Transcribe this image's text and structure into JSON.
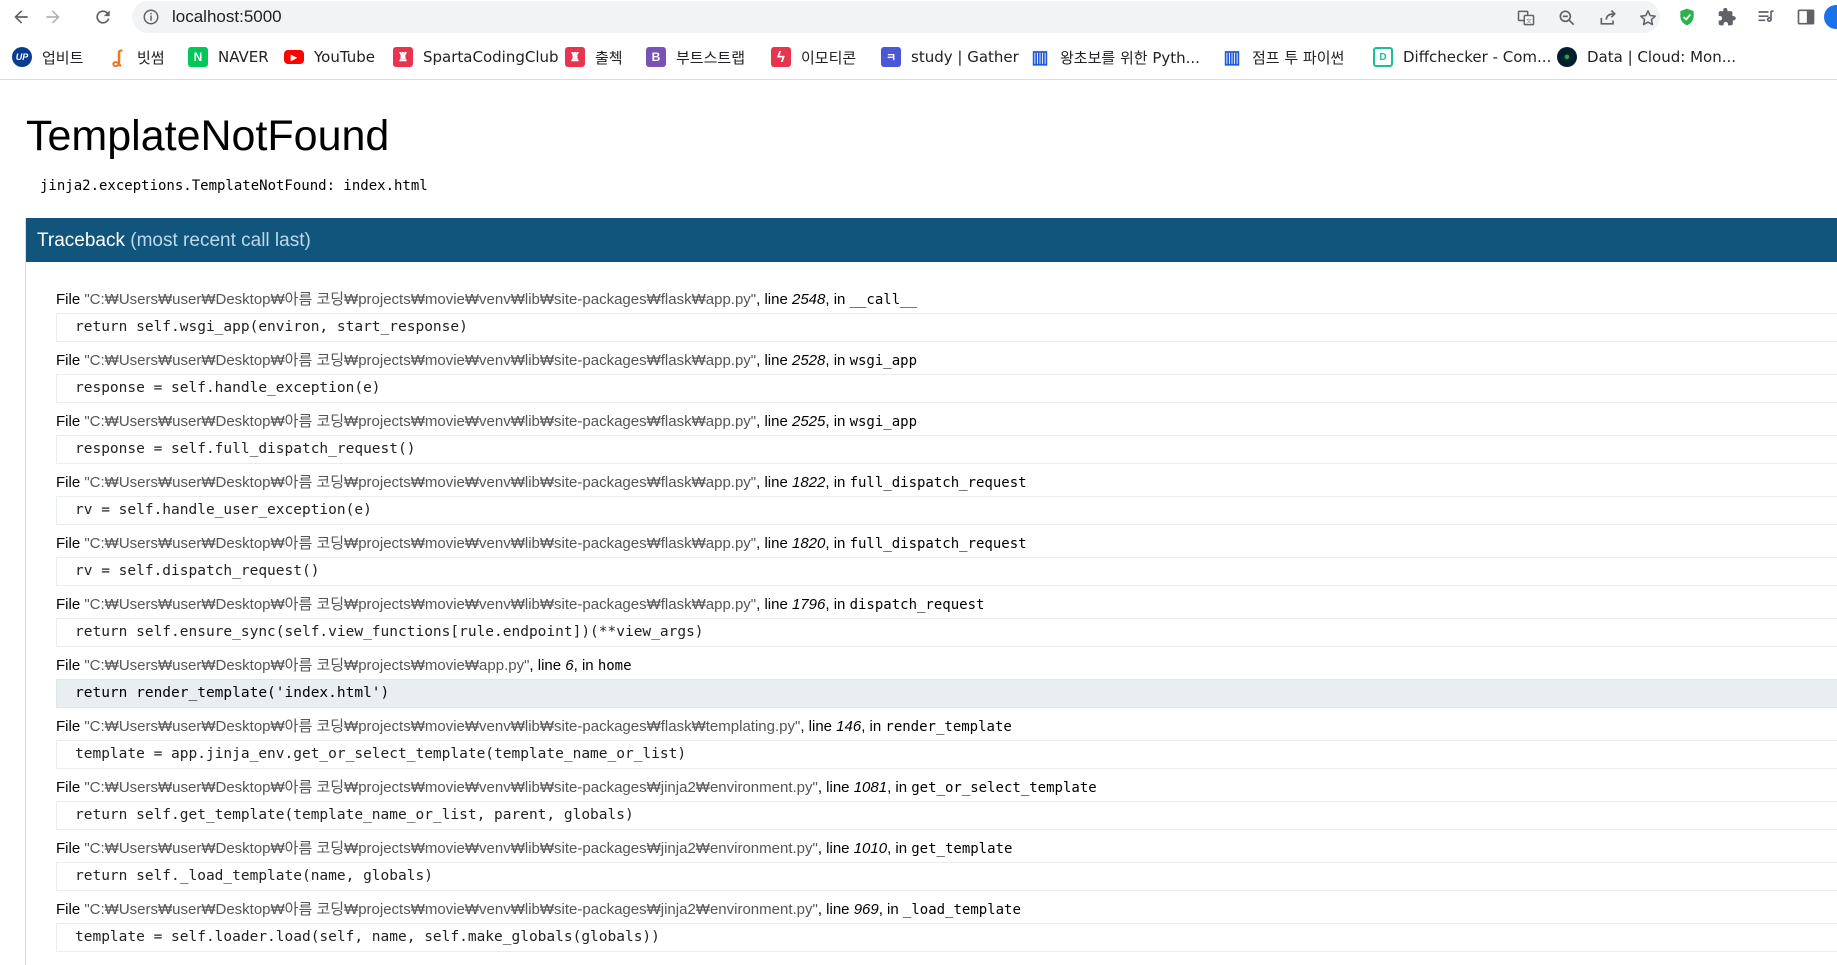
{
  "browser": {
    "url": "localhost:5000",
    "bookmarks": [
      {
        "label": "업비트",
        "icon": "upbit-icon",
        "color": "#0a3d91",
        "glyph": "UP"
      },
      {
        "label": "빗썸",
        "icon": "bithumb-icon",
        "color": "#f37321",
        "glyph": "ʆ"
      },
      {
        "label": "NAVER",
        "icon": "naver-icon",
        "color": "#03c75a",
        "glyph": "N"
      },
      {
        "label": "YouTube",
        "icon": "youtube-icon",
        "color": "#ff0000",
        "glyph": "▶"
      },
      {
        "label": "SpartaCodingClub",
        "icon": "sparta-icon",
        "color": "#e8344e",
        "glyph": "♜"
      },
      {
        "label": "출첵",
        "icon": "sparta-icon",
        "color": "#e8344e",
        "glyph": "♜"
      },
      {
        "label": "부트스트랩",
        "icon": "bootstrap-icon",
        "color": "#7952b3",
        "glyph": "B"
      },
      {
        "label": "이모티콘",
        "icon": "emoticon-icon",
        "color": "#e8344e",
        "glyph": "ϟ"
      },
      {
        "label": "study | Gather",
        "icon": "gather-icon",
        "color": "#4a57d6",
        "glyph": "ㅋ"
      },
      {
        "label": "왕초보를 위한 Pyth...",
        "icon": "book-icon",
        "color": "#1f5bd8",
        "glyph": "▥"
      },
      {
        "label": "점프 투 파이썬",
        "icon": "book-icon",
        "color": "#1f5bd8",
        "glyph": "▥"
      },
      {
        "label": "Diffchecker - Com...",
        "icon": "diffchecker-icon",
        "color": "#1bbd9b",
        "glyph": "D"
      },
      {
        "label": "Data | Cloud: Mon...",
        "icon": "mongodb-icon",
        "color": "#13aa52",
        "glyph": "●"
      }
    ]
  },
  "page": {
    "title": "TemplateNotFound",
    "message": "jinja2.exceptions.TemplateNotFound: index.html",
    "traceback_label": "Traceback",
    "traceback_sub": "(most recent call last)",
    "frames": [
      {
        "file": "\"C:₩Users₩user₩Desktop₩아름 코딩₩projects₩movie₩venv₩lib₩site-packages₩flask₩app.py\"",
        "line": "2548",
        "func": "__call__",
        "code": "return self.wsgi_app(environ, start_response)",
        "current": false
      },
      {
        "file": "\"C:₩Users₩user₩Desktop₩아름 코딩₩projects₩movie₩venv₩lib₩site-packages₩flask₩app.py\"",
        "line": "2528",
        "func": "wsgi_app",
        "code": "response = self.handle_exception(e)",
        "current": false
      },
      {
        "file": "\"C:₩Users₩user₩Desktop₩아름 코딩₩projects₩movie₩venv₩lib₩site-packages₩flask₩app.py\"",
        "line": "2525",
        "func": "wsgi_app",
        "code": "response = self.full_dispatch_request()",
        "current": false
      },
      {
        "file": "\"C:₩Users₩user₩Desktop₩아름 코딩₩projects₩movie₩venv₩lib₩site-packages₩flask₩app.py\"",
        "line": "1822",
        "func": "full_dispatch_request",
        "code": "rv = self.handle_user_exception(e)",
        "current": false
      },
      {
        "file": "\"C:₩Users₩user₩Desktop₩아름 코딩₩projects₩movie₩venv₩lib₩site-packages₩flask₩app.py\"",
        "line": "1820",
        "func": "full_dispatch_request",
        "code": "rv = self.dispatch_request()",
        "current": false
      },
      {
        "file": "\"C:₩Users₩user₩Desktop₩아름 코딩₩projects₩movie₩venv₩lib₩site-packages₩flask₩app.py\"",
        "line": "1796",
        "func": "dispatch_request",
        "code": "return self.ensure_sync(self.view_functions[rule.endpoint])(**view_args)",
        "current": false
      },
      {
        "file": "\"C:₩Users₩user₩Desktop₩아름 코딩₩projects₩movie₩app.py\"",
        "line": "6",
        "func": "home",
        "code": "return render_template('index.html')",
        "current": true
      },
      {
        "file": "\"C:₩Users₩user₩Desktop₩아름 코딩₩projects₩movie₩venv₩lib₩site-packages₩flask₩templating.py\"",
        "line": "146",
        "func": "render_template",
        "code": "template = app.jinja_env.get_or_select_template(template_name_or_list)",
        "current": false
      },
      {
        "file": "\"C:₩Users₩user₩Desktop₩아름 코딩₩projects₩movie₩venv₩lib₩site-packages₩jinja2₩environment.py\"",
        "line": "1081",
        "func": "get_or_select_template",
        "code": "return self.get_template(template_name_or_list, parent, globals)",
        "current": false
      },
      {
        "file": "\"C:₩Users₩user₩Desktop₩아름 코딩₩projects₩movie₩venv₩lib₩site-packages₩jinja2₩environment.py\"",
        "line": "1010",
        "func": "get_template",
        "code": "return self._load_template(name, globals)",
        "current": false
      },
      {
        "file": "\"C:₩Users₩user₩Desktop₩아름 코딩₩projects₩movie₩venv₩lib₩site-packages₩jinja2₩environment.py\"",
        "line": "969",
        "func": "_load_template",
        "code": "template = self.loader.load(self, name, self.make_globals(globals))",
        "current": false
      }
    ]
  },
  "colors": {
    "traceback_header": "#11557c",
    "current_frame": "#e9eef1"
  }
}
